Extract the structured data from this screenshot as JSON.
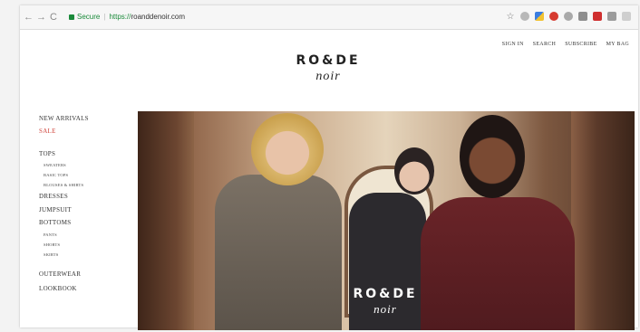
{
  "browser": {
    "secure_label": "Secure",
    "url_scheme": "https://",
    "url_host": "roanddenoir.com",
    "nav": {
      "back": "←",
      "forward": "→",
      "reload": "C"
    }
  },
  "site": {
    "logo_main": "RO&DE",
    "logo_sub": "noir",
    "top_nav": [
      "SIGN IN",
      "SEARCH",
      "SUBSCRIBE",
      "MY BAG"
    ]
  },
  "sidebar": {
    "new_arrivals": "NEW ARRIVALS",
    "sale": "SALE",
    "tops": "TOPS",
    "sweaters": "SWEATERS",
    "basic_tops": "BASIC TOPS",
    "blouses_shirts": "BLOUSES & SHIRTS",
    "dresses": "DRESSES",
    "jumpsuit": "JUMPSUIT",
    "bottoms": "BOTTOMS",
    "pants": "PANTS",
    "shorts": "SHORTS",
    "skirts": "SKIRTS",
    "outerwear": "OUTERWEAR",
    "lookbook": "LOOKBOOK"
  },
  "hero": {
    "logo_main": "RO&DE",
    "logo_sub": "noir"
  },
  "colors": {
    "sale": "#d0443b",
    "secure": "#1a8a3a"
  }
}
